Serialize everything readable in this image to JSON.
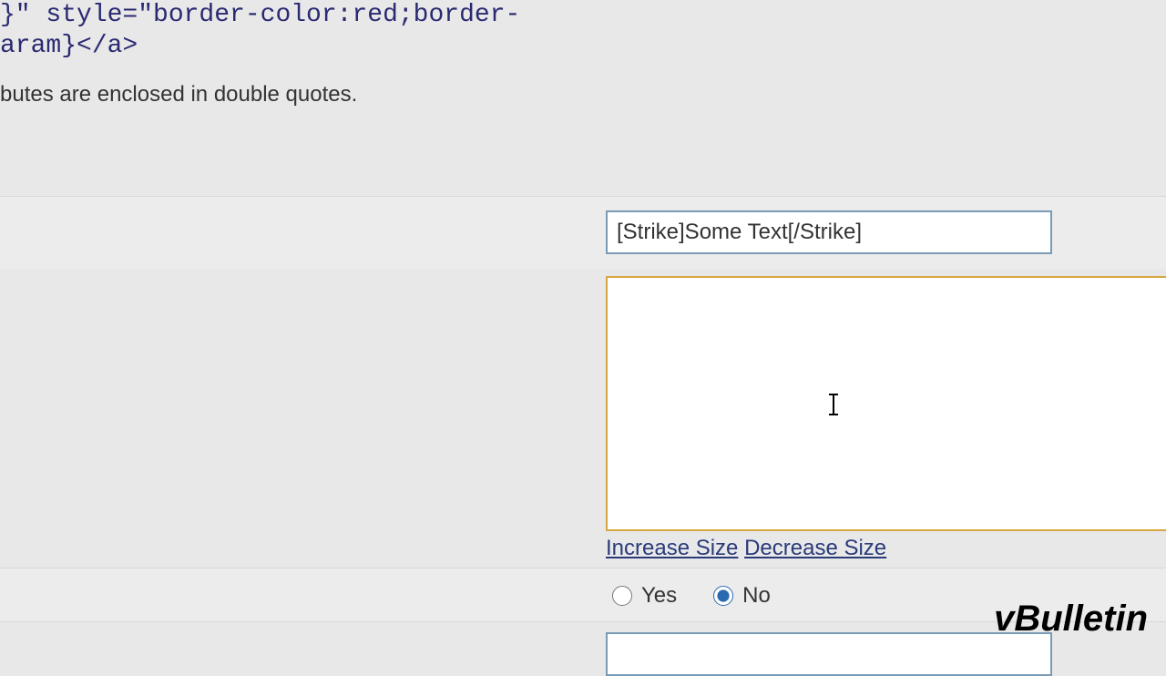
{
  "code_fragment": "}\" style=\"border-color:red;border-\naram}</a>",
  "hint_text": "butes are enclosed in double quotes.",
  "title_input_value": "[Strike]Some Text[/Strike]",
  "textarea_value": "",
  "links": {
    "increase": "Increase Size",
    "decrease": "Decrease Size"
  },
  "radio": {
    "yes_label": "Yes",
    "no_label": "No",
    "selected": "no"
  },
  "bottom_input_value": "",
  "watermark": "vBulletin"
}
